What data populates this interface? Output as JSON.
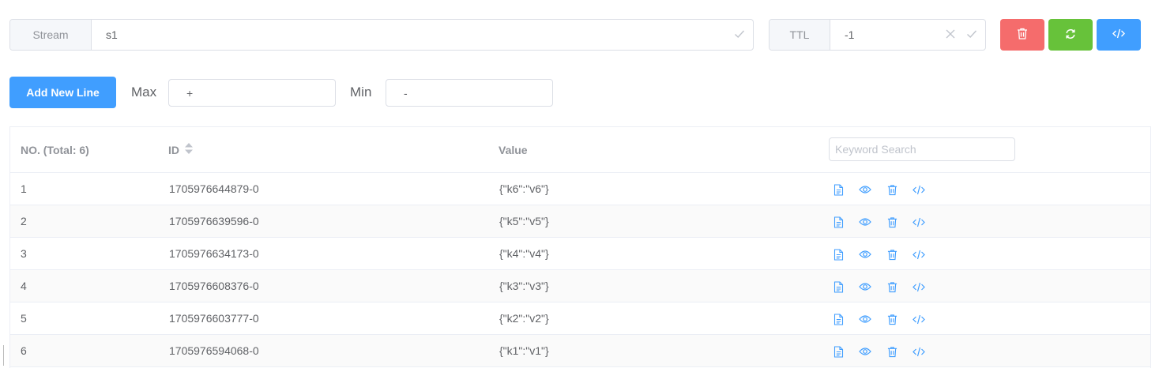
{
  "stream": {
    "label": "Stream",
    "value": "s1"
  },
  "ttl": {
    "label": "TTL",
    "value": "-1"
  },
  "colors": {
    "danger": "#f56c6c",
    "success": "#67c23a",
    "primary": "#409eff"
  },
  "toolbar": {
    "icons": [
      "trash-icon",
      "refresh-icon",
      "code-icon"
    ]
  },
  "filter": {
    "add_label": "Add New Line",
    "max_label": "Max",
    "max_value": "+",
    "min_label": "Min",
    "min_value": "-"
  },
  "table": {
    "headers": {
      "no": "NO. (Total: 6)",
      "id": "ID",
      "value": "Value"
    },
    "search_placeholder": "Keyword Search",
    "row_icons": [
      "document-icon",
      "eye-icon",
      "trash-icon",
      "code-icon"
    ],
    "rows": [
      {
        "no": "1",
        "id": "1705976644879-0",
        "value": "{\"k6\":\"v6\"}"
      },
      {
        "no": "2",
        "id": "1705976639596-0",
        "value": "{\"k5\":\"v5\"}"
      },
      {
        "no": "3",
        "id": "1705976634173-0",
        "value": "{\"k4\":\"v4\"}"
      },
      {
        "no": "4",
        "id": "1705976608376-0",
        "value": "{\"k3\":\"v3\"}"
      },
      {
        "no": "5",
        "id": "1705976603777-0",
        "value": "{\"k2\":\"v2\"}"
      },
      {
        "no": "6",
        "id": "1705976594068-0",
        "value": "{\"k1\":\"v1\"}"
      }
    ]
  }
}
